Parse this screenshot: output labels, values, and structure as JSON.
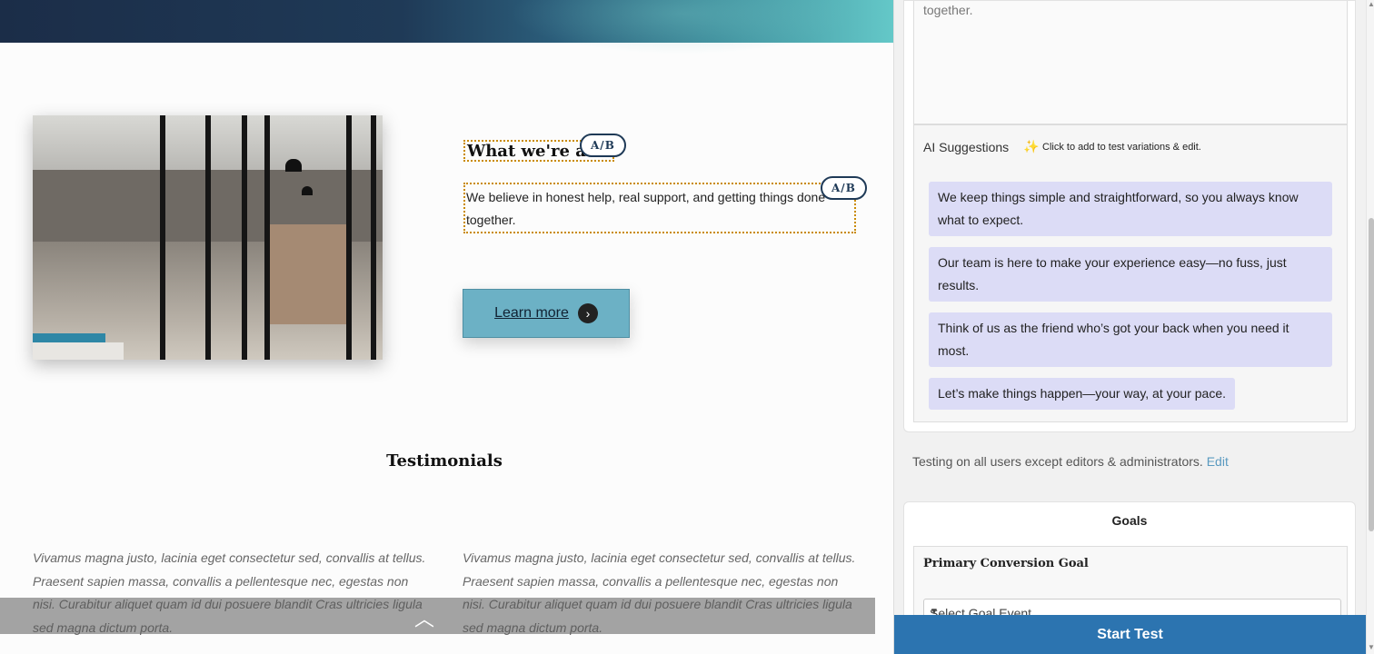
{
  "preview": {
    "heading": "What we're about",
    "ab_badge": "A/B",
    "body_text": "We believe in honest help, real support, and getting things done together.",
    "learn_more": "Learn more",
    "testimonials_title": "Testimonials",
    "testimonials": [
      "Vivamus magna justo, lacinia eget consectetur sed, convallis at tellus. Praesent sapien massa, convallis a pellentesque nec, egestas non nisi. Curabitur aliquet quam id dui posuere blandit Cras ultricies ligula sed magna dictum porta.",
      "Vivamus magna justo, lacinia eget consectetur sed, convallis at tellus. Praesent sapien massa, convallis a pellentesque nec, egestas non nisi. Curabitur aliquet quam id dui posuere blandit Cras ultricies ligula sed magna dictum porta."
    ]
  },
  "panel": {
    "preview_text": "together.",
    "ai_title": "AI Suggestions",
    "ai_hint": "Click to add to test variations & edit.",
    "suggestions": [
      "We keep things simple and straightforward, so you always know what to expect.",
      "Our team is here to make your experience easy—no fuss, just results.",
      "Think of us as the friend who’s got your back when you need it most.",
      "Let’s make things happen—your way, at your pace."
    ],
    "testing_note": "Testing on all users except editors & administrators.",
    "testing_edit": "Edit",
    "goals_title": "Goals",
    "primary_goal_label": "Primary Conversion Goal",
    "goal_select_placeholder": "Select Goal Event",
    "start_test": "Start Test"
  },
  "icons": {
    "sparkle": "sparkle-icon",
    "arrow": "arrow-right-icon",
    "chevron_up": "chevron-up-icon",
    "caret": "caret-down-icon"
  },
  "colors": {
    "accent": "#2c74b0",
    "suggestion_bg": "#dcdcf6",
    "ab_outline": "#c98a00",
    "learn_more_bg": "#6cb1c5"
  }
}
